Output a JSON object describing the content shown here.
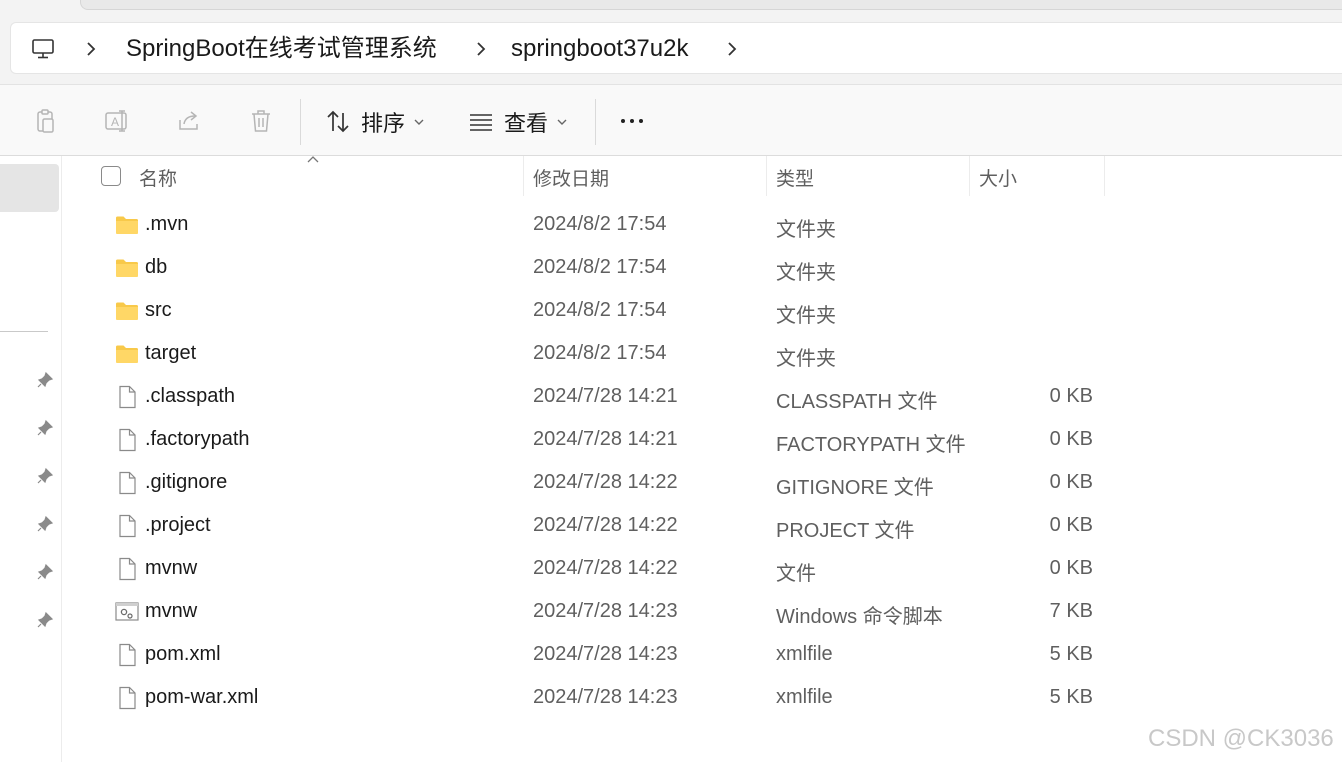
{
  "breadcrumb": {
    "items": [
      "SpringBoot在线考试管理系统",
      "springboot37u2k"
    ]
  },
  "toolbar": {
    "sort_label": "排序",
    "view_label": "查看",
    "more_label": "···"
  },
  "columns": {
    "name": "名称",
    "date": "修改日期",
    "type": "类型",
    "size": "大小"
  },
  "files": [
    {
      "name": ".mvn",
      "date": "2024/8/2 17:54",
      "type": "文件夹",
      "size": "",
      "icon": "folder-icon"
    },
    {
      "name": "db",
      "date": "2024/8/2 17:54",
      "type": "文件夹",
      "size": "",
      "icon": "folder-icon"
    },
    {
      "name": "src",
      "date": "2024/8/2 17:54",
      "type": "文件夹",
      "size": "",
      "icon": "folder-icon"
    },
    {
      "name": "target",
      "date": "2024/8/2 17:54",
      "type": "文件夹",
      "size": "",
      "icon": "folder-icon"
    },
    {
      "name": ".classpath",
      "date": "2024/7/28 14:21",
      "type": "CLASSPATH 文件",
      "size": "0 KB",
      "icon": "file-icon"
    },
    {
      "name": ".factorypath",
      "date": "2024/7/28 14:21",
      "type": "FACTORYPATH 文件",
      "size": "0 KB",
      "icon": "file-icon"
    },
    {
      "name": ".gitignore",
      "date": "2024/7/28 14:22",
      "type": "GITIGNORE 文件",
      "size": "0 KB",
      "icon": "file-icon"
    },
    {
      "name": ".project",
      "date": "2024/7/28 14:22",
      "type": "PROJECT 文件",
      "size": "0 KB",
      "icon": "file-icon"
    },
    {
      "name": "mvnw",
      "date": "2024/7/28 14:22",
      "type": "文件",
      "size": "0 KB",
      "icon": "file-icon"
    },
    {
      "name": "mvnw",
      "date": "2024/7/28 14:23",
      "type": "Windows 命令脚本",
      "size": "7 KB",
      "icon": "script-icon"
    },
    {
      "name": "pom.xml",
      "date": "2024/7/28 14:23",
      "type": "xmlfile",
      "size": "5 KB",
      "icon": "file-icon"
    },
    {
      "name": "pom-war.xml",
      "date": "2024/7/28 14:23",
      "type": "xmlfile",
      "size": "5 KB",
      "icon": "file-icon"
    }
  ],
  "watermark": "CSDN @CK3036",
  "colors": {
    "folder": "#F8C94A",
    "icon_gray": "#9a9a9a",
    "selected_nav": "#e5e5e5"
  }
}
